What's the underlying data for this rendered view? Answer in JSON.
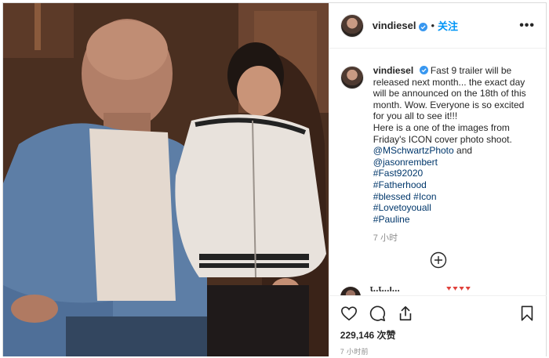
{
  "header": {
    "username": "vindiesel",
    "separator": "•",
    "follow_label": "关注",
    "more_label": "•••"
  },
  "caption": {
    "username": "vindiesel",
    "lines": [
      "Fast 9 trailer will be released next month... the exact day will be announced on the 18th of this month. Wow. Everyone is so excited for you all to see it!!!",
      "Here is a one of the images from Friday's ICON cover photo shoot."
    ],
    "mention_1": "@MSchwartzPhoto",
    "and_word": "and",
    "mention_2": "@jasonrembert",
    "hashtags": [
      "#Fast92020",
      "#Fatherhood",
      "#blessed #Icon",
      "#Lovetoyouall",
      "#Pauline"
    ],
    "time": "7 小时"
  },
  "comment_peek": {
    "name": "t..t...i...",
    "emoji": "♥♥♥♥"
  },
  "actions": {
    "likes": "229,146 次赞",
    "time": "7 小时前"
  },
  "icons": {
    "like": "heart-icon",
    "comment": "comment-icon",
    "share": "share-icon",
    "save": "bookmark-icon",
    "load_more": "plus-circle-icon",
    "verified": "verified-badge-icon",
    "accent": "#0095f6"
  }
}
